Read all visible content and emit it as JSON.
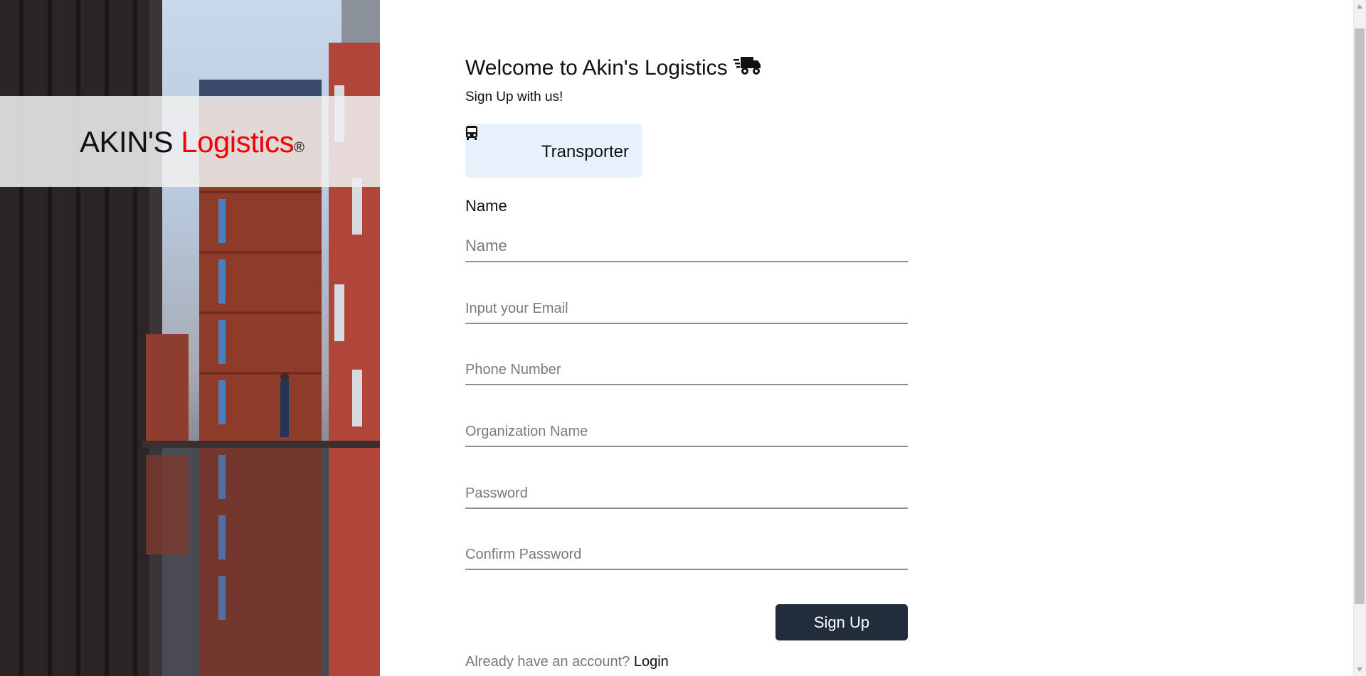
{
  "hero": {
    "brand_main": "AKIN'S ",
    "brand_accent": "Logistics",
    "brand_mark": "®",
    "accent_color": "#f20000"
  },
  "form": {
    "title": "Welcome to Akin's Logistics",
    "title_icon": "truck-fast-icon",
    "subtitle": "Sign Up with us!",
    "role": {
      "label": "Transporter",
      "icon": "bus-icon"
    },
    "name_label": "Name",
    "fields": {
      "name_placeholder": "Name",
      "email_placeholder": "Input your Email",
      "phone_placeholder": "Phone Number",
      "org_placeholder": "Organization Name",
      "password_placeholder": "Password",
      "confirm_placeholder": "Confirm Password"
    },
    "submit_label": "Sign Up",
    "account_prompt": "Already have an account? ",
    "login_label": "Login",
    "button_color": "#222d3c"
  }
}
